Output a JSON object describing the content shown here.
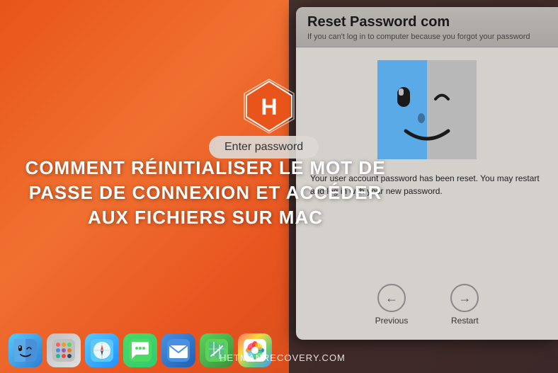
{
  "background": {
    "color_start": "#e8541a",
    "color_end": "#c04010"
  },
  "logo": {
    "alt": "Hetman Software Logo"
  },
  "title": {
    "line1": "COMMENT RÉINITIALISER LE MOT DE",
    "line2": "PASSE DE CONNEXION ET ACCÉDER",
    "line3": "AUX FICHIERS SUR MAC"
  },
  "enter_password_bubble": {
    "label": "Enter password"
  },
  "dialog": {
    "title": "Reset Password com",
    "subtitle": "If you can't log in to computer because you forgot your password",
    "body_text": "Your user account password has been reset. You may restart and log in with your new password.",
    "buttons": [
      {
        "icon": "←",
        "label": "Previous"
      },
      {
        "icon": "→",
        "label": "Restart"
      }
    ]
  },
  "dock": {
    "items": [
      {
        "name": "finder",
        "emoji": "🔵",
        "label": "Finder"
      },
      {
        "name": "launchpad",
        "emoji": "⬜",
        "label": "Launchpad"
      },
      {
        "name": "safari",
        "emoji": "🧭",
        "label": "Safari"
      },
      {
        "name": "messages",
        "emoji": "💬",
        "label": "Messages"
      },
      {
        "name": "mail",
        "emoji": "✉️",
        "label": "Mail"
      },
      {
        "name": "maps",
        "emoji": "🗺️",
        "label": "Maps"
      },
      {
        "name": "photos",
        "emoji": "🌸",
        "label": "Photos"
      }
    ]
  },
  "website": {
    "url": "HETMANRECOVERY.COM"
  }
}
